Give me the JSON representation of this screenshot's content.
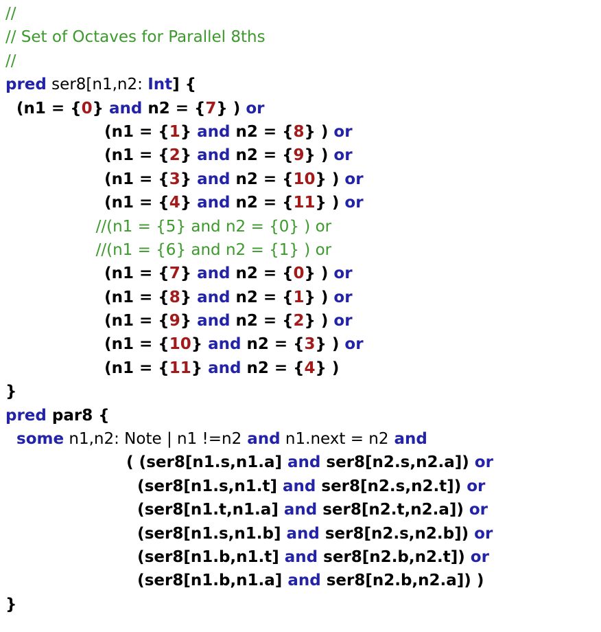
{
  "colors": {
    "comment": "#3b9a2b",
    "keyword": "#2323a8",
    "number": "#a21a1a",
    "plain": "#000000",
    "background": "#ffffff"
  },
  "lines": [
    [
      {
        "t": "//",
        "c": "comment"
      }
    ],
    [
      {
        "t": "// Set of Octaves for Parallel 8ths",
        "c": "comment"
      }
    ],
    [
      {
        "t": "//",
        "c": "comment"
      }
    ],
    [
      {
        "t": "pred",
        "c": "keyword"
      },
      {
        "t": " ser8[n1,n2: "
      },
      {
        "t": "Int",
        "c": "keyword"
      },
      {
        "t": "] {",
        "b": true
      }
    ],
    [
      {
        "t": "  (n1 = {",
        "b": true
      },
      {
        "t": "0",
        "c": "number"
      },
      {
        "t": "}",
        "b": true
      },
      {
        "t": " and",
        "c": "keyword"
      },
      {
        "t": " n2 = {",
        "b": true
      },
      {
        "t": "7",
        "c": "number"
      },
      {
        "t": "} )",
        "b": true
      },
      {
        "t": " or",
        "c": "keyword"
      }
    ],
    [
      {
        "t": "                  (n1 = {",
        "b": true
      },
      {
        "t": "1",
        "c": "number"
      },
      {
        "t": "}",
        "b": true
      },
      {
        "t": " and",
        "c": "keyword"
      },
      {
        "t": " n2 = {",
        "b": true
      },
      {
        "t": "8",
        "c": "number"
      },
      {
        "t": "} )",
        "b": true
      },
      {
        "t": " or",
        "c": "keyword"
      }
    ],
    [
      {
        "t": "                  (n1 = {",
        "b": true
      },
      {
        "t": "2",
        "c": "number"
      },
      {
        "t": "}",
        "b": true
      },
      {
        "t": " and",
        "c": "keyword"
      },
      {
        "t": " n2 = {",
        "b": true
      },
      {
        "t": "9",
        "c": "number"
      },
      {
        "t": "} )",
        "b": true
      },
      {
        "t": " or",
        "c": "keyword"
      }
    ],
    [
      {
        "t": "                  (n1 = {",
        "b": true
      },
      {
        "t": "3",
        "c": "number"
      },
      {
        "t": "}",
        "b": true
      },
      {
        "t": " and",
        "c": "keyword"
      },
      {
        "t": " n2 = {",
        "b": true
      },
      {
        "t": "10",
        "c": "number"
      },
      {
        "t": "} )",
        "b": true
      },
      {
        "t": " or",
        "c": "keyword"
      }
    ],
    [
      {
        "t": "                  (n1 = {",
        "b": true
      },
      {
        "t": "4",
        "c": "number"
      },
      {
        "t": "}",
        "b": true
      },
      {
        "t": " and",
        "c": "keyword"
      },
      {
        "t": " n2 = {",
        "b": true
      },
      {
        "t": "11",
        "c": "number"
      },
      {
        "t": "} )",
        "b": true
      },
      {
        "t": " or",
        "c": "keyword"
      }
    ],
    [
      {
        "t": "                  //(n1 = {5} and n2 = {0} ) or",
        "c": "comment"
      }
    ],
    [
      {
        "t": "                  //(n1 = {6} and n2 = {1} ) or",
        "c": "comment"
      }
    ],
    [
      {
        "t": "                  (n1 = {",
        "b": true
      },
      {
        "t": "7",
        "c": "number"
      },
      {
        "t": "}",
        "b": true
      },
      {
        "t": " and",
        "c": "keyword"
      },
      {
        "t": " n2 = {",
        "b": true
      },
      {
        "t": "0",
        "c": "number"
      },
      {
        "t": "} )",
        "b": true
      },
      {
        "t": " or",
        "c": "keyword"
      }
    ],
    [
      {
        "t": "                  (n1 = {",
        "b": true
      },
      {
        "t": "8",
        "c": "number"
      },
      {
        "t": "}",
        "b": true
      },
      {
        "t": " and",
        "c": "keyword"
      },
      {
        "t": " n2 = {",
        "b": true
      },
      {
        "t": "1",
        "c": "number"
      },
      {
        "t": "} )",
        "b": true
      },
      {
        "t": " or",
        "c": "keyword"
      }
    ],
    [
      {
        "t": "                  (n1 = {",
        "b": true
      },
      {
        "t": "9",
        "c": "number"
      },
      {
        "t": "}",
        "b": true
      },
      {
        "t": " and",
        "c": "keyword"
      },
      {
        "t": " n2 = {",
        "b": true
      },
      {
        "t": "2",
        "c": "number"
      },
      {
        "t": "} )",
        "b": true
      },
      {
        "t": " or",
        "c": "keyword"
      }
    ],
    [
      {
        "t": "                  (n1 = {",
        "b": true
      },
      {
        "t": "10",
        "c": "number"
      },
      {
        "t": "}",
        "b": true
      },
      {
        "t": " and",
        "c": "keyword"
      },
      {
        "t": " n2 = {",
        "b": true
      },
      {
        "t": "3",
        "c": "number"
      },
      {
        "t": "} )",
        "b": true
      },
      {
        "t": " or",
        "c": "keyword"
      }
    ],
    [
      {
        "t": "                  (n1 = {",
        "b": true
      },
      {
        "t": "11",
        "c": "number"
      },
      {
        "t": "}",
        "b": true
      },
      {
        "t": " and",
        "c": "keyword"
      },
      {
        "t": " n2 = {",
        "b": true
      },
      {
        "t": "4",
        "c": "number"
      },
      {
        "t": "} )",
        "b": true
      }
    ],
    [
      {
        "t": "}",
        "b": true
      }
    ],
    [
      {
        "t": "pred",
        "c": "keyword"
      },
      {
        "t": " par8 {",
        "b": true
      }
    ],
    [
      {
        "t": "  some",
        "c": "keyword"
      },
      {
        "t": " n1,n2: Note | n1 !=n2"
      },
      {
        "t": " and",
        "c": "keyword"
      },
      {
        "t": " n1.next = n2"
      },
      {
        "t": " and",
        "c": "keyword"
      }
    ],
    [
      {
        "t": "                      ( (ser8[n1.s,n1.a]",
        "b": true
      },
      {
        "t": " and",
        "c": "keyword"
      },
      {
        "t": " ser8[n2.s,n2.a])",
        "b": true
      },
      {
        "t": " or",
        "c": "keyword"
      }
    ],
    [
      {
        "t": "                        (ser8[n1.s,n1.t]",
        "b": true
      },
      {
        "t": " and",
        "c": "keyword"
      },
      {
        "t": " ser8[n2.s,n2.t])",
        "b": true
      },
      {
        "t": " or",
        "c": "keyword"
      }
    ],
    [
      {
        "t": "                        (ser8[n1.t,n1.a]",
        "b": true
      },
      {
        "t": " and",
        "c": "keyword"
      },
      {
        "t": " ser8[n2.t,n2.a])",
        "b": true
      },
      {
        "t": " or",
        "c": "keyword"
      }
    ],
    [
      {
        "t": "                        (ser8[n1.s,n1.b]",
        "b": true
      },
      {
        "t": " and",
        "c": "keyword"
      },
      {
        "t": " ser8[n2.s,n2.b])",
        "b": true
      },
      {
        "t": " or",
        "c": "keyword"
      }
    ],
    [
      {
        "t": "                        (ser8[n1.b,n1.t]",
        "b": true
      },
      {
        "t": " and",
        "c": "keyword"
      },
      {
        "t": " ser8[n2.b,n2.t])",
        "b": true
      },
      {
        "t": " or",
        "c": "keyword"
      }
    ],
    [
      {
        "t": "                        (ser8[n1.b,n1.a]",
        "b": true
      },
      {
        "t": " and",
        "c": "keyword"
      },
      {
        "t": " ser8[n2.b,n2.a]) )",
        "b": true
      }
    ],
    [
      {
        "t": "}",
        "b": true
      }
    ]
  ]
}
